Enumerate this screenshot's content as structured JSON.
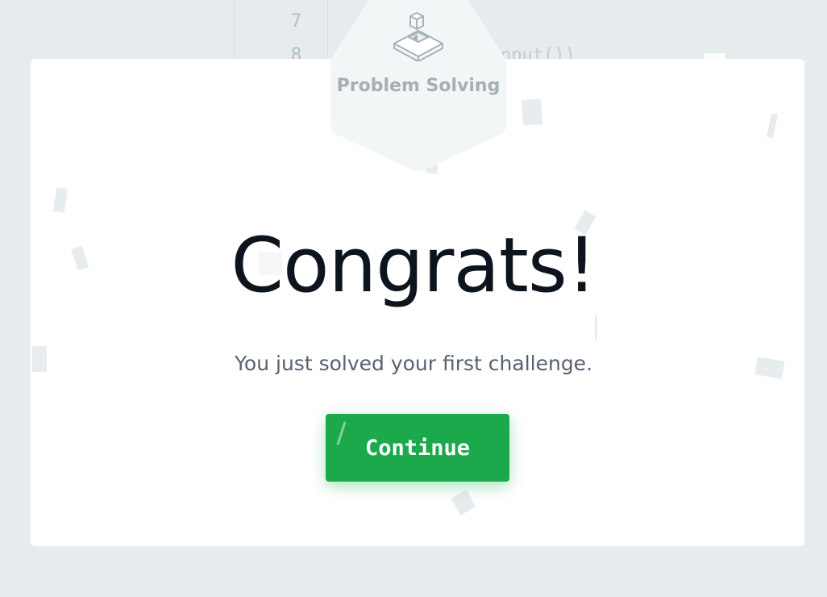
{
  "editor": {
    "line_7": "7",
    "line_8": "8",
    "code_fragment": "nput())"
  },
  "badge": {
    "label": "Problem Solving",
    "icon": "problem-solving-icon"
  },
  "modal": {
    "title": "Congrats!",
    "message": "You just solved your first challenge.",
    "continue_label": "Continue"
  },
  "colors": {
    "primary": "#1ba94c",
    "title": "#0e141e",
    "subtitle": "#576170",
    "badge_text": "#a7aeb4"
  }
}
